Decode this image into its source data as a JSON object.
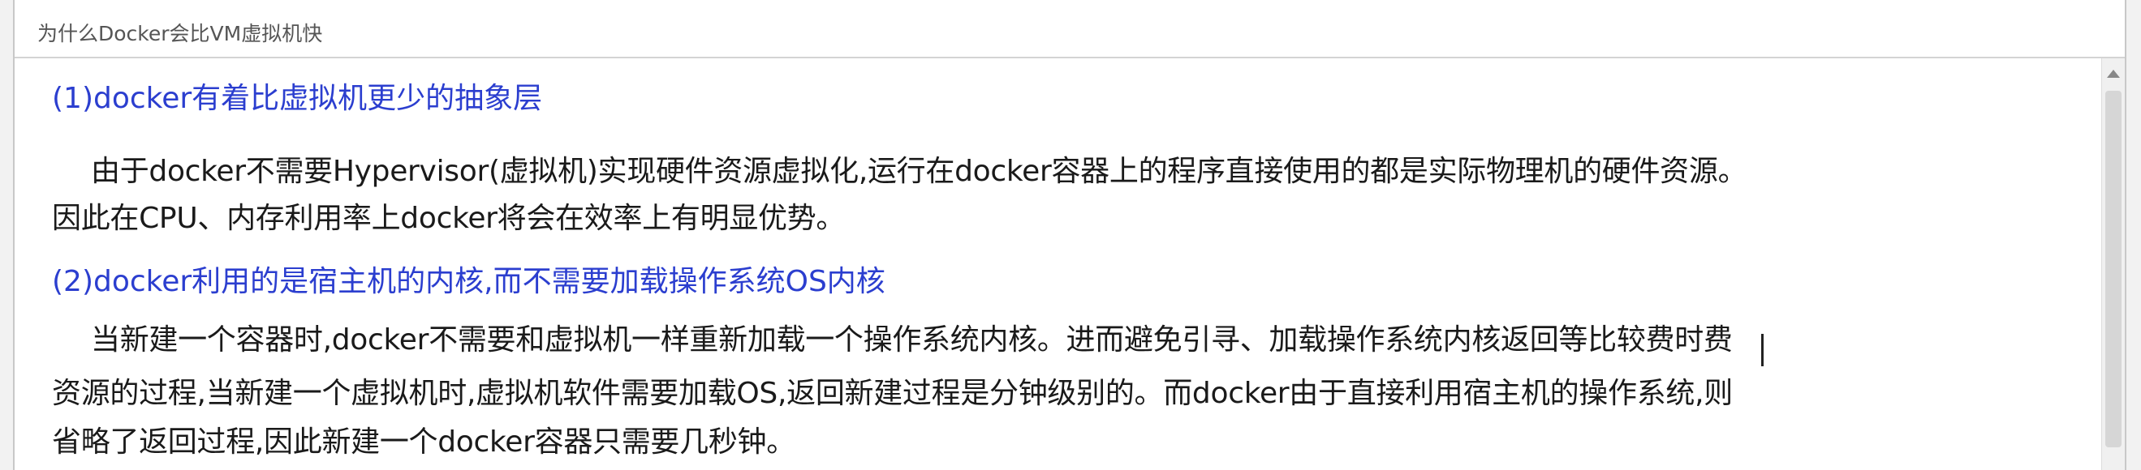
{
  "window": {
    "title": "为什么Docker会比VM虚拟机快"
  },
  "colors": {
    "heading": "#2b3ecf",
    "body_text": "#1a1a1a",
    "title_text": "#555555"
  },
  "content": {
    "section1": {
      "heading": "(1)docker有着比虚拟机更少的抽象层",
      "lines": [
        "由于docker不需要Hypervisor(虚拟机)实现硬件资源虚拟化,运行在docker容器上的程序直接使用的都是实际物理机的硬件资源。",
        "因此在CPU、内存利用率上docker将会在效率上有明显优势。"
      ]
    },
    "section2": {
      "heading": "(2)docker利用的是宿主机的内核,而不需要加载操作系统OS内核",
      "lines": [
        "当新建一个容器时,docker不需要和虚拟机一样重新加载一个操作系统内核。进而避免引寻、加载操作系统内核返回等比较费时费",
        "资源的过程,当新建一个虚拟机时,虚拟机软件需要加载OS,返回新建过程是分钟级别的。而docker由于直接利用宿主机的操作系统,则",
        "省略了返回过程,因此新建一个docker容器只需要几秒钟。"
      ]
    }
  }
}
